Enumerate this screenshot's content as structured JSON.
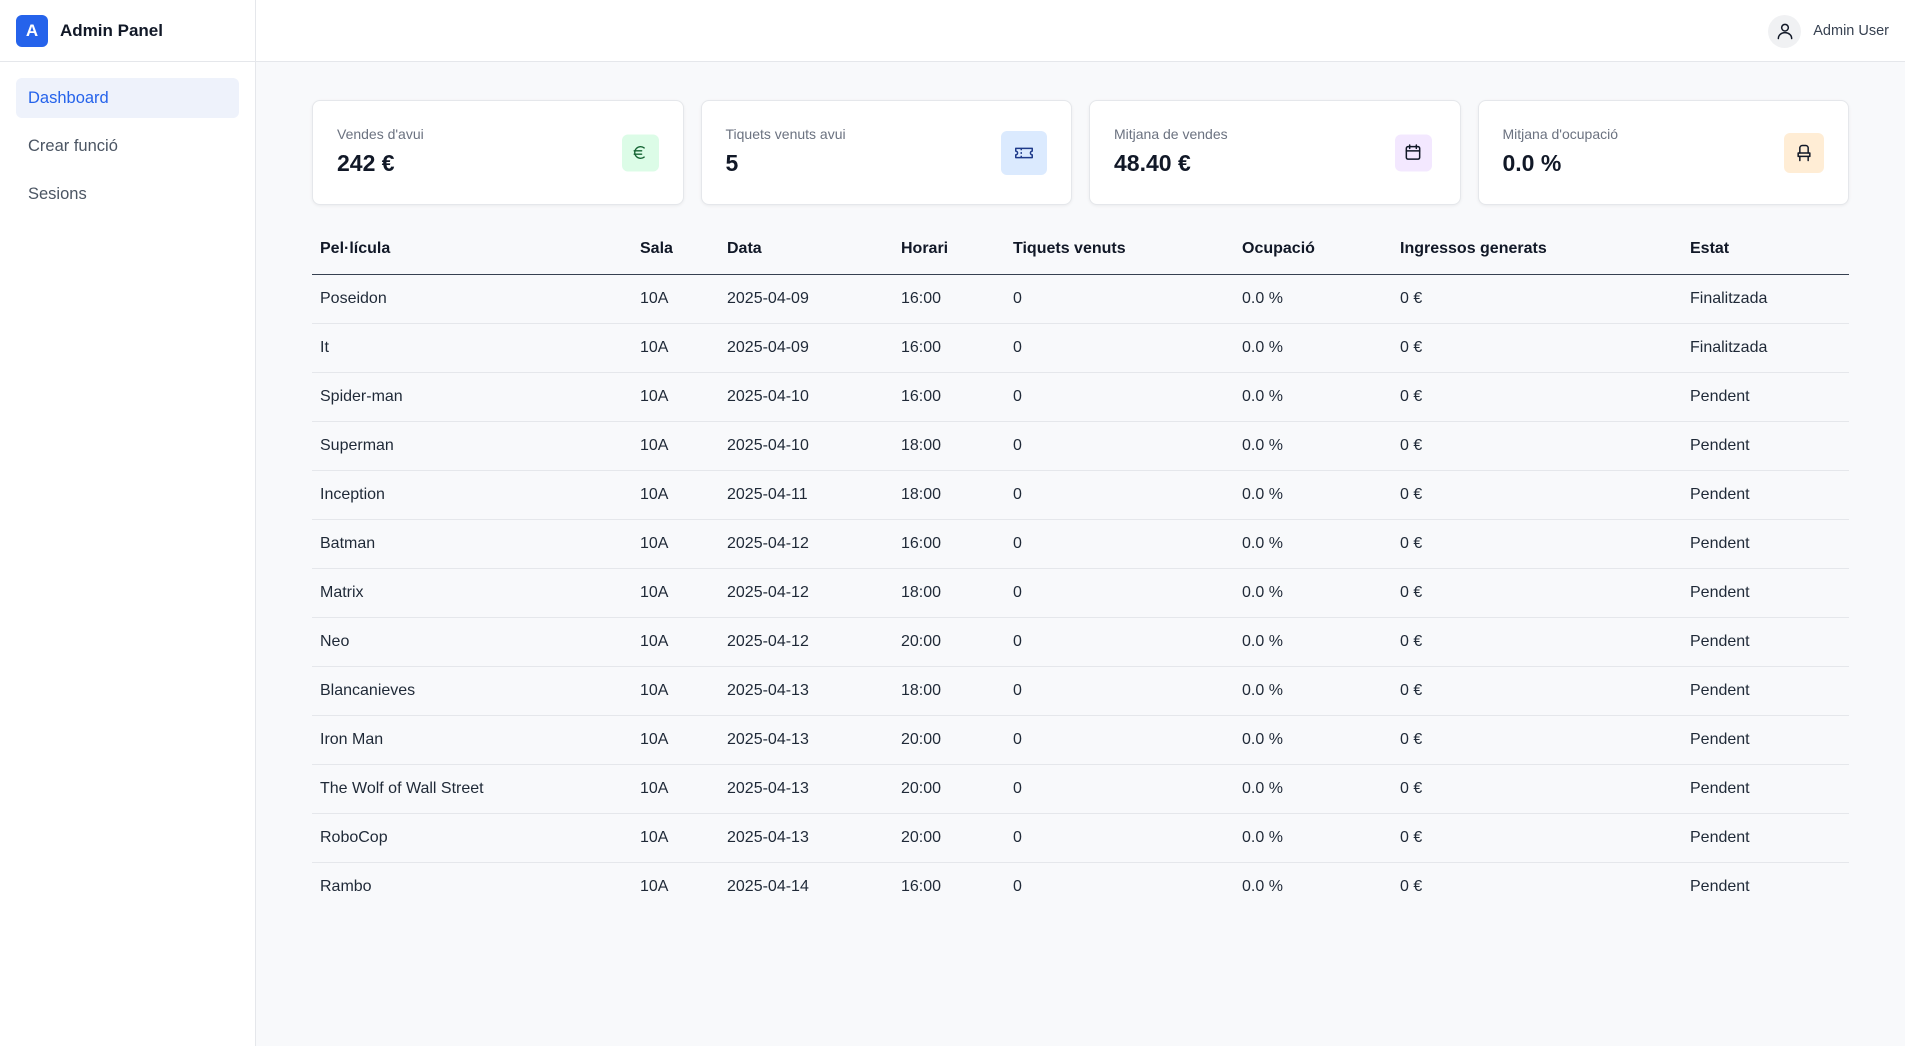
{
  "brand": {
    "logo_letter": "A",
    "title": "Admin Panel",
    "accent": "#2563eb"
  },
  "sidebar": {
    "items": [
      {
        "label": "Dashboard",
        "active": true
      },
      {
        "label": "Crear funció",
        "active": false
      },
      {
        "label": "Sesions",
        "active": false
      }
    ]
  },
  "header": {
    "user_name": "Admin User",
    "user_icon": "user-icon"
  },
  "cards": [
    {
      "label": "Vendes d'avui",
      "value": "242 €",
      "icon": "euro-icon",
      "icon_bg": "#dcfce7"
    },
    {
      "label": "Tiquets venuts avui",
      "value": "5",
      "icon": "ticket-icon",
      "icon_bg": "#dbeafe"
    },
    {
      "label": "Mitjana de vendes",
      "value": "48.40 €",
      "icon": "calendar-icon",
      "icon_bg": "#f3e8ff"
    },
    {
      "label": "Mitjana d'ocupació",
      "value": "0.0 %",
      "icon": "seat-icon",
      "icon_bg": "#ffedd5"
    }
  ],
  "table": {
    "columns": [
      "Pel·lícula",
      "Sala",
      "Data",
      "Horari",
      "Tiquets venuts",
      "Ocupació",
      "Ingressos generats",
      "Estat"
    ],
    "rows": [
      [
        "Poseidon",
        "10A",
        "2025-04-09",
        "16:00",
        "0",
        "0.0 %",
        "0 €",
        "Finalitzada"
      ],
      [
        "It",
        "10A",
        "2025-04-09",
        "16:00",
        "0",
        "0.0 %",
        "0 €",
        "Finalitzada"
      ],
      [
        "Spider-man",
        "10A",
        "2025-04-10",
        "16:00",
        "0",
        "0.0 %",
        "0 €",
        "Pendent"
      ],
      [
        "Superman",
        "10A",
        "2025-04-10",
        "18:00",
        "0",
        "0.0 %",
        "0 €",
        "Pendent"
      ],
      [
        "Inception",
        "10A",
        "2025-04-11",
        "18:00",
        "0",
        "0.0 %",
        "0 €",
        "Pendent"
      ],
      [
        "Batman",
        "10A",
        "2025-04-12",
        "16:00",
        "0",
        "0.0 %",
        "0 €",
        "Pendent"
      ],
      [
        "Matrix",
        "10A",
        "2025-04-12",
        "18:00",
        "0",
        "0.0 %",
        "0 €",
        "Pendent"
      ],
      [
        "Neo",
        "10A",
        "2025-04-12",
        "20:00",
        "0",
        "0.0 %",
        "0 €",
        "Pendent"
      ],
      [
        "Blancanieves",
        "10A",
        "2025-04-13",
        "18:00",
        "0",
        "0.0 %",
        "0 €",
        "Pendent"
      ],
      [
        "Iron Man",
        "10A",
        "2025-04-13",
        "20:00",
        "0",
        "0.0 %",
        "0 €",
        "Pendent"
      ],
      [
        "The Wolf of Wall Street",
        "10A",
        "2025-04-13",
        "20:00",
        "0",
        "0.0 %",
        "0 €",
        "Pendent"
      ],
      [
        "RoboCop",
        "10A",
        "2025-04-13",
        "20:00",
        "0",
        "0.0 %",
        "0 €",
        "Pendent"
      ],
      [
        "Rambo",
        "10A",
        "2025-04-14",
        "16:00",
        "0",
        "0.0 %",
        "0 €",
        "Pendent"
      ]
    ]
  }
}
